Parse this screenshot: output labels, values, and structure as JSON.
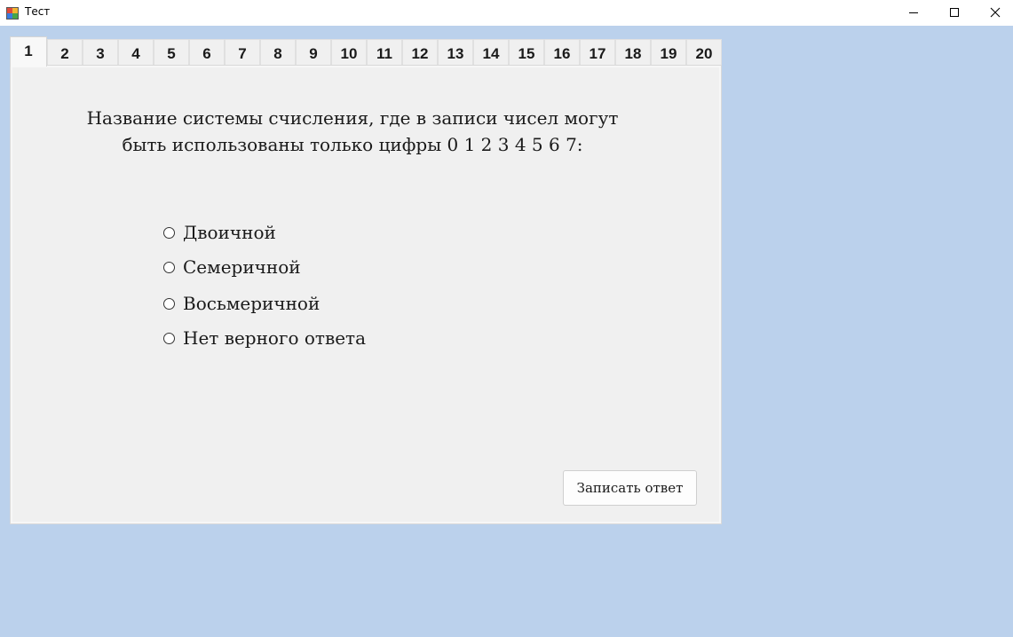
{
  "window": {
    "title": "Тест",
    "controls": {
      "minimize_icon": "minimize-icon",
      "maximize_icon": "maximize-icon",
      "close_icon": "close-icon"
    }
  },
  "tabs": [
    "1",
    "2",
    "3",
    "4",
    "5",
    "6",
    "7",
    "8",
    "9",
    "10",
    "11",
    "12",
    "13",
    "14",
    "15",
    "16",
    "17",
    "18",
    "19",
    "20"
  ],
  "active_tab": "1",
  "question": {
    "line1": "Название системы счисления, где в записи чисел могут",
    "line2": "быть использованы только цифры 0 1 2 3 4 5 6 7:"
  },
  "options": [
    "Двоичной",
    "Семеричной",
    "Восьмеричной",
    "Нет верного ответа"
  ],
  "submit_label": "Записать ответ",
  "colors": {
    "background": "#bbd1ec",
    "panel": "#f0f0f0",
    "titlebar": "#ffffff"
  }
}
